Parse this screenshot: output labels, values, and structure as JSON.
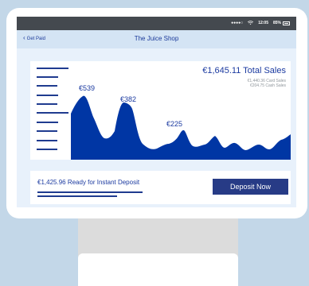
{
  "status_bar": {
    "signal": "●●●●○",
    "time": "12:05",
    "battery": "85%"
  },
  "nav": {
    "back_label": "Get Paid",
    "title": "The Juice Shop"
  },
  "sales": {
    "total": "€1,645.11 Total Sales",
    "card_sales": "€1,440.36 Card Sales",
    "cash_sales": "€204.75 Cash Sales"
  },
  "chart_data": {
    "type": "area",
    "color": "#0036a4",
    "annotations": [
      "€539",
      "€382",
      "€225"
    ]
  },
  "deposit": {
    "ready_text": "€1,425.96 Ready for Instant Deposit",
    "button_label": "Deposit Now"
  },
  "colors": {
    "accent": "#1b3aa0",
    "chart_fill": "#0036a4",
    "button": "#273b86",
    "screen_bg": "#e8f1fb",
    "nav_bg": "#d4e4f4"
  }
}
